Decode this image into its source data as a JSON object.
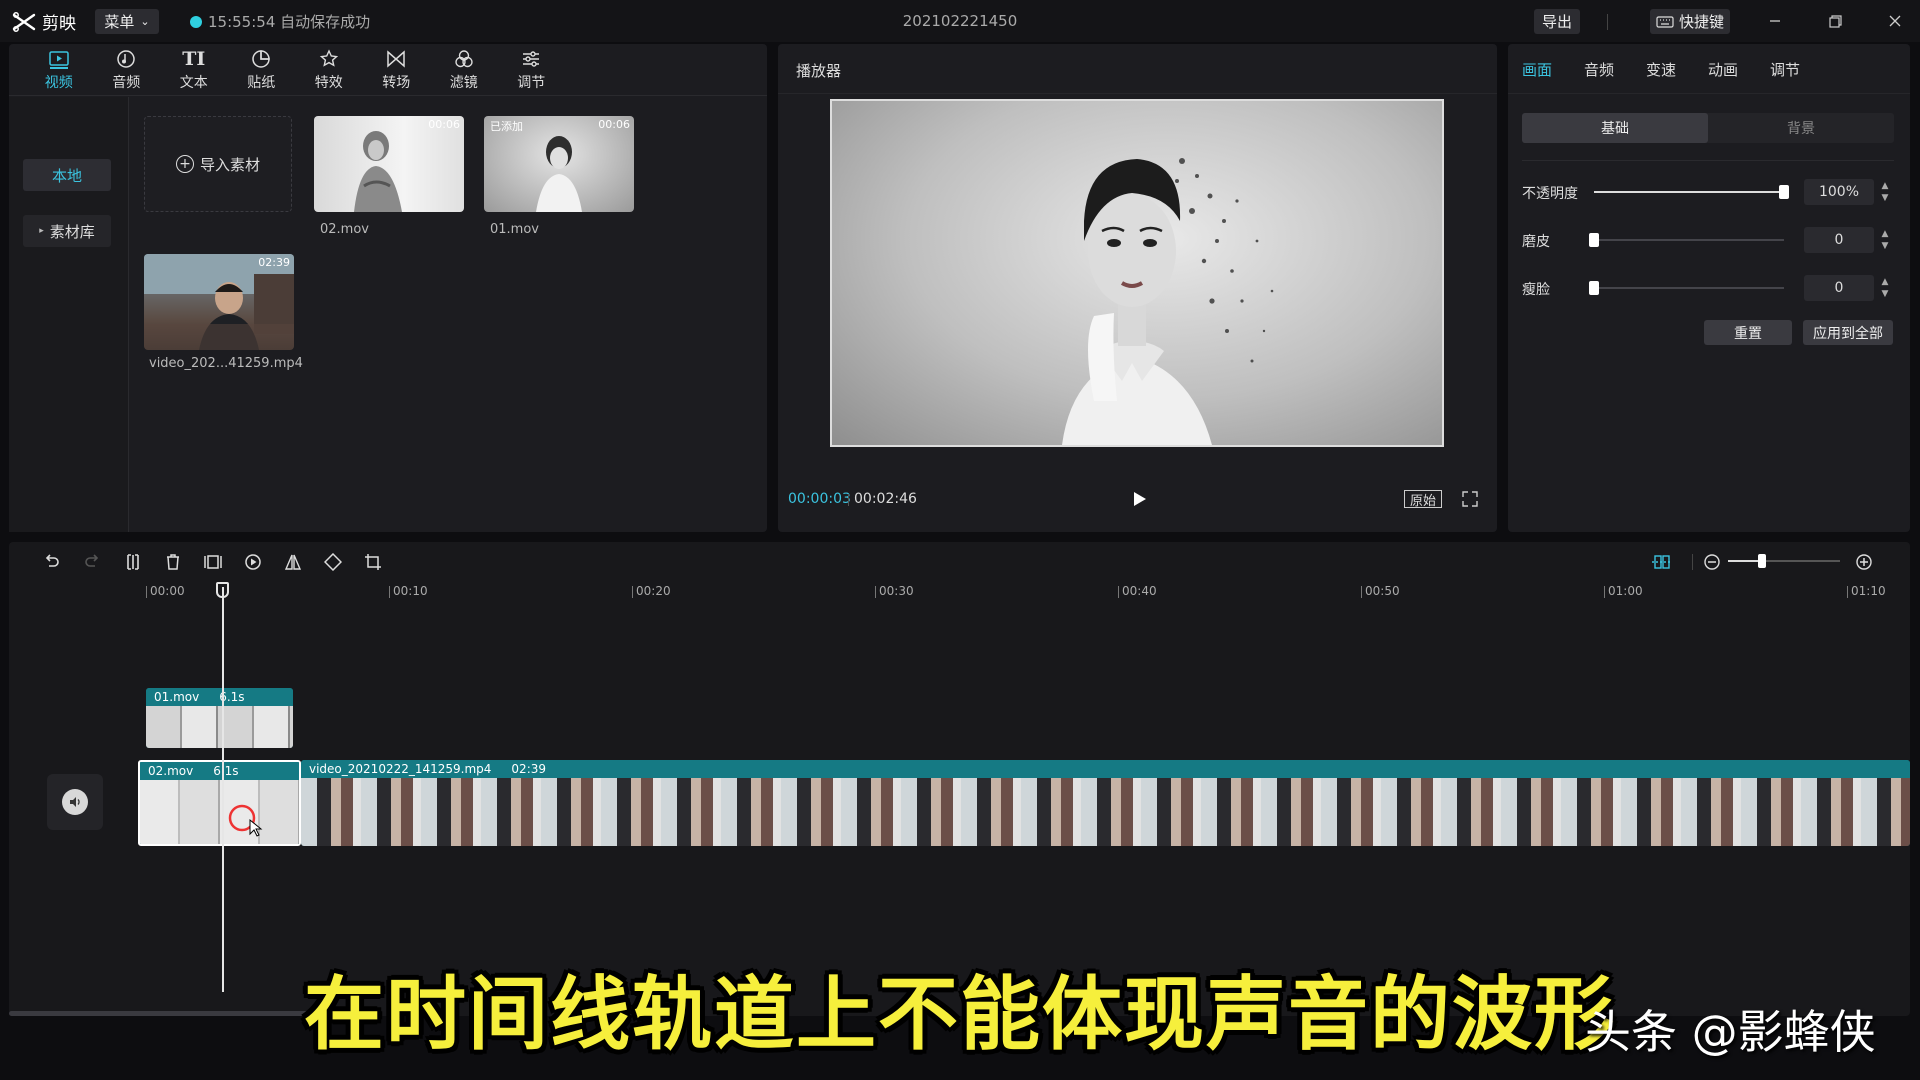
{
  "app": {
    "name": "剪映",
    "menu_label": "菜单",
    "autosave": "15:55:54 自动保存成功",
    "project_title": "202102221450",
    "export_label": "导出",
    "shortcut_label": "快捷键"
  },
  "media": {
    "tabs": [
      {
        "label": "视频",
        "icon": "video-icon"
      },
      {
        "label": "音频",
        "icon": "audio-icon"
      },
      {
        "label": "文本",
        "icon": "text-icon"
      },
      {
        "label": "贴纸",
        "icon": "sticker-icon"
      },
      {
        "label": "特效",
        "icon": "effects-icon"
      },
      {
        "label": "转场",
        "icon": "transition-icon"
      },
      {
        "label": "滤镜",
        "icon": "filter-icon"
      },
      {
        "label": "调节",
        "icon": "adjust-icon"
      }
    ],
    "side": {
      "local": "本地",
      "library": "素材库"
    },
    "import_label": "导入素材",
    "items": [
      {
        "name": "02.mov",
        "badge": "",
        "duration": "00:06"
      },
      {
        "name": "01.mov",
        "badge": "已添加",
        "duration": "00:06"
      },
      {
        "name": "video_202...41259.mp4",
        "badge": "",
        "duration": "02:39"
      }
    ]
  },
  "player": {
    "title": "播放器",
    "current_time": "00:00:03",
    "total_time": "00:02:46",
    "ratio_label": "原始"
  },
  "props": {
    "tabs": [
      "画面",
      "音频",
      "变速",
      "动画",
      "调节"
    ],
    "segments": [
      "基础",
      "背景"
    ],
    "rows": [
      {
        "label": "不透明度",
        "value": "100%",
        "level": 1.0
      },
      {
        "label": "磨皮",
        "value": "0",
        "level": 0
      },
      {
        "label": "瘦脸",
        "value": "0",
        "level": 0
      }
    ],
    "reset_label": "重置",
    "apply_all_label": "应用到全部"
  },
  "timeline": {
    "ticks": [
      "00:00",
      "00:10",
      "00:20",
      "00:30",
      "00:40",
      "00:50",
      "01:00",
      "01:10"
    ],
    "clips": {
      "overlay": {
        "name": "01.mov",
        "duration": "6.1s"
      },
      "main_a": {
        "name": "02.mov",
        "duration": "6.1s"
      },
      "main_b": {
        "name": "video_20210222_141259.mp4",
        "duration": "02:39"
      }
    }
  },
  "subtitle": "在时间线轨道上不能体现声音的波形",
  "watermark": "头条 @影蜂侠",
  "colors": {
    "accent": "#3bc4e0",
    "clip": "#157a84",
    "subtitle": "#f6ef3c"
  }
}
